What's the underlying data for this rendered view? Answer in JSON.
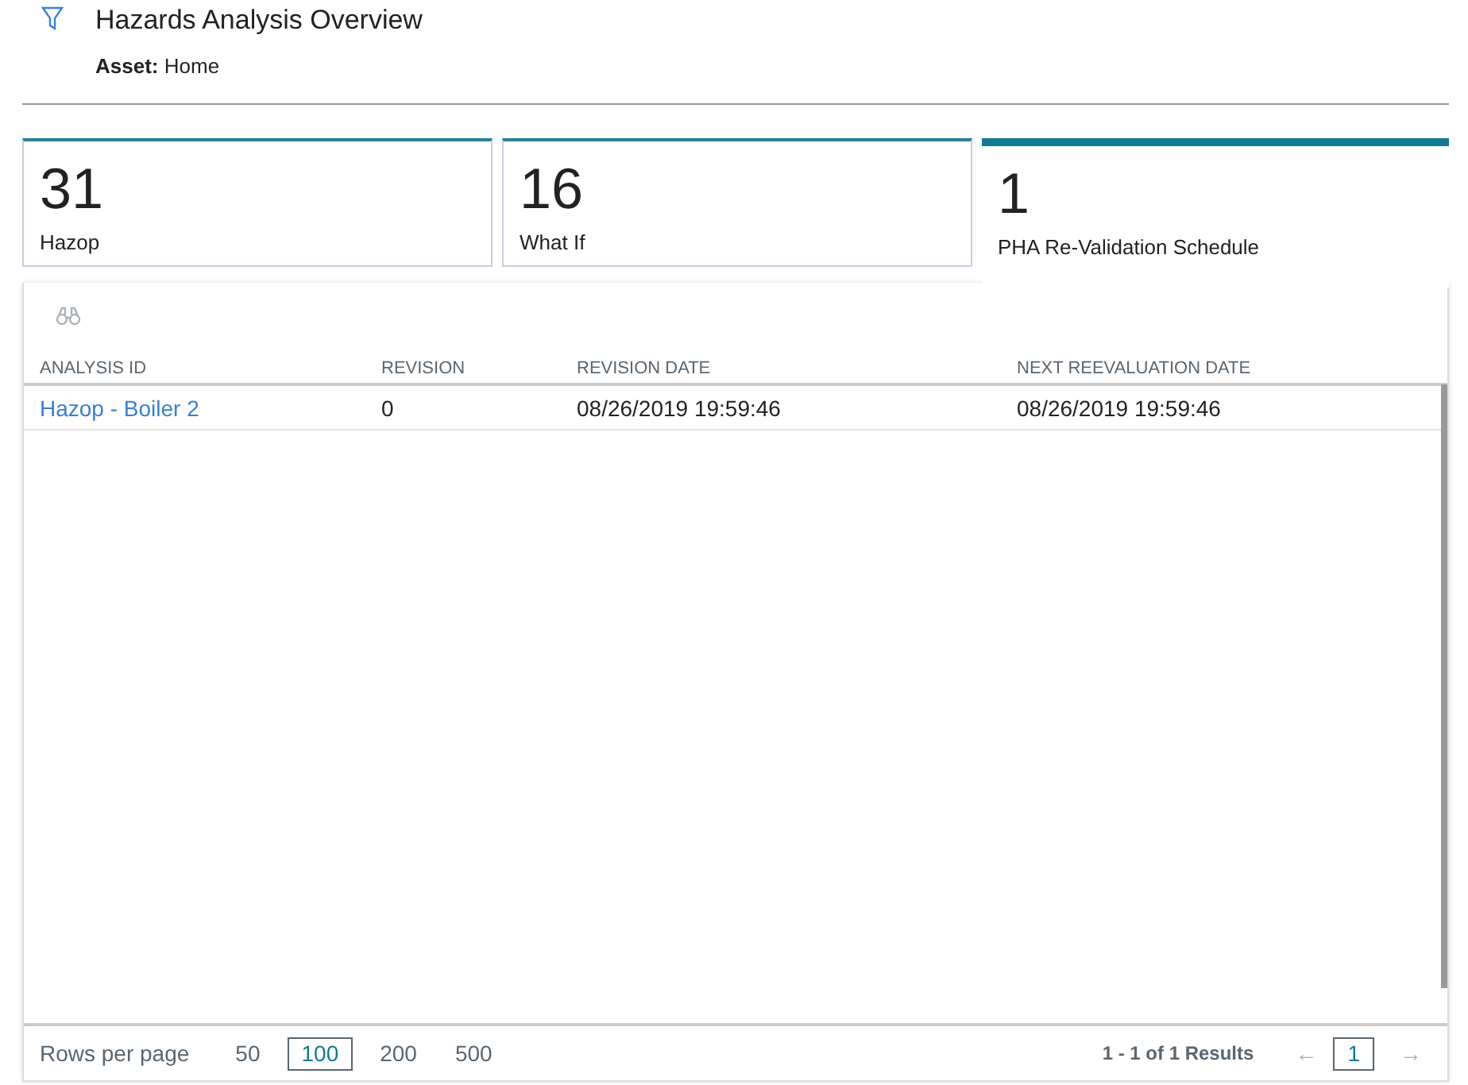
{
  "header": {
    "title": "Hazards Analysis Overview",
    "asset_label": "Asset:",
    "asset_value": "Home"
  },
  "tiles": [
    {
      "count": "31",
      "label": "Hazop",
      "selected": false
    },
    {
      "count": "16",
      "label": "What If",
      "selected": false
    },
    {
      "count": "1",
      "label": "PHA Re-Validation Schedule",
      "selected": true
    }
  ],
  "table": {
    "columns": [
      "ANALYSIS ID",
      "REVISION",
      "REVISION DATE",
      "NEXT REEVALUATION DATE"
    ],
    "rows": [
      {
        "cells": [
          "Hazop - Boiler 2",
          "0",
          "08/26/2019 19:59:46",
          "08/26/2019 19:59:46"
        ]
      }
    ]
  },
  "pager": {
    "rows_label": "Rows per page",
    "sizes": [
      {
        "label": "50",
        "selected": false
      },
      {
        "label": "100",
        "selected": true
      },
      {
        "label": "200",
        "selected": false
      },
      {
        "label": "500",
        "selected": false
      }
    ],
    "results": "1 - 1 of 1 Results",
    "prev": "←",
    "pages": [
      {
        "label": "1",
        "selected": true
      }
    ],
    "next": "→"
  }
}
